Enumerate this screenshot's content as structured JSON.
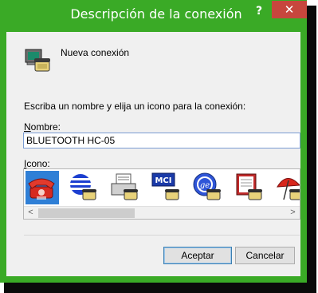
{
  "window": {
    "title": "Descripción de la conexión",
    "help_label": "?",
    "close_label": "✕",
    "accent_color": "#3aaa26",
    "close_color": "#c7463d"
  },
  "header": {
    "connection_name": "Nueva conexión",
    "icon": "phone-connection-icon"
  },
  "form": {
    "prompt": "Escriba un nombre y elija un icono para la conexión:",
    "name_label_accel": "N",
    "name_label_rest": "ombre:",
    "name_value": "BLUETOOTH HC-05",
    "icon_label_accel": "I",
    "icon_label_rest": "cono:"
  },
  "icon_list": {
    "items": [
      {
        "icon": "red-phone-icon",
        "selected": true
      },
      {
        "icon": "blue-globe-icon",
        "selected": false
      },
      {
        "icon": "fax-machine-icon",
        "selected": false
      },
      {
        "icon": "mci-logo-icon",
        "selected": false
      },
      {
        "icon": "ge-logo-icon",
        "selected": false
      },
      {
        "icon": "notepad-phone-icon",
        "selected": false
      },
      {
        "icon": "umbrella-phone-icon",
        "selected": false
      }
    ],
    "scroll_left": "<",
    "scroll_right": ">"
  },
  "buttons": {
    "ok_label": "Aceptar",
    "cancel_label": "Cancelar"
  }
}
